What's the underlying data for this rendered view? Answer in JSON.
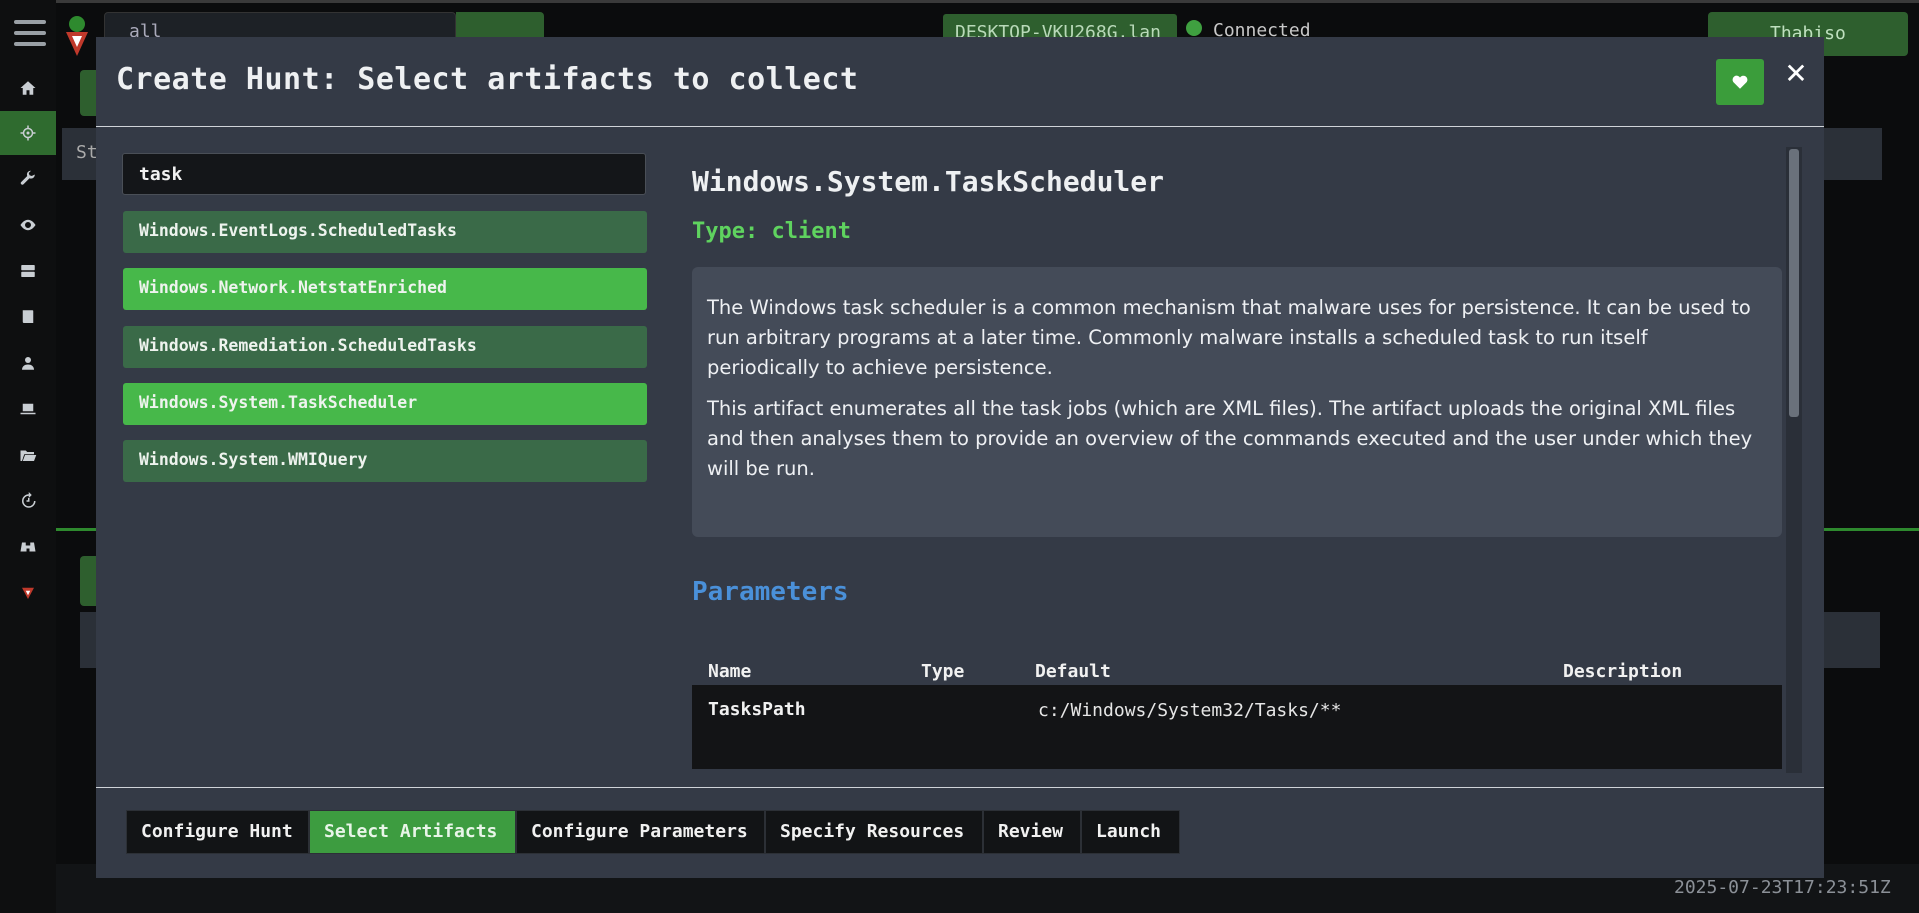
{
  "background": {
    "search_value": "all",
    "hostname": "DESKTOP-VKU268G.lan",
    "connection_status": "Connected",
    "user_name": "Thabiso",
    "table_header_start": "St",
    "timestamp": "2025-07-23T17:23:51Z"
  },
  "modal": {
    "title": "Create Hunt: Select artifacts to collect",
    "search_value": "task",
    "artifacts": [
      {
        "label": "Windows.EventLogs.ScheduledTasks",
        "selected": false
      },
      {
        "label": "Windows.Network.NetstatEnriched",
        "selected": true
      },
      {
        "label": "Windows.Remediation.ScheduledTasks",
        "selected": false
      },
      {
        "label": "Windows.System.TaskScheduler",
        "selected": true
      },
      {
        "label": "Windows.System.WMIQuery",
        "selected": false
      }
    ],
    "detail": {
      "name": "Windows.System.TaskScheduler",
      "type": "Type: client",
      "description": [
        "The Windows task scheduler is a common mechanism that malware uses for persistence. It can be used to run arbitrary programs at a later time. Commonly malware installs a scheduled task to run itself periodically to achieve persistence.",
        "This artifact enumerates all the task jobs (which are XML files). The artifact uploads the original XML files and then analyses them to provide an overview of the commands executed and the user under which they will be run."
      ],
      "parameters_heading": "Parameters",
      "param_columns": [
        "Name",
        "Type",
        "Default",
        "Description"
      ],
      "params": [
        {
          "name": "TasksPath",
          "type": "",
          "default": "c:/Windows/System32/Tasks/**",
          "description": ""
        }
      ]
    },
    "wizard_steps": [
      {
        "label": "Configure Hunt",
        "active": false
      },
      {
        "label": "Select Artifacts",
        "active": true
      },
      {
        "label": "Configure Parameters",
        "active": false
      },
      {
        "label": "Specify Resources",
        "active": false
      },
      {
        "label": "Review",
        "active": false
      },
      {
        "label": "Launch",
        "active": false
      }
    ]
  },
  "colors": {
    "accent_green": "#47b84a",
    "dim_green": "#3a6a48",
    "type_green": "#5fd35f",
    "heading_blue": "#4a90d9"
  },
  "icons": {
    "sidebar": [
      "home-icon",
      "crosshair-icon",
      "wrench-icon",
      "eye-icon",
      "server-icon",
      "book-icon",
      "user-icon",
      "laptop-icon",
      "folder-open-icon",
      "history-icon",
      "binoculars-icon",
      "velociraptor-logo-icon"
    ],
    "favorite": "heart-icon",
    "close": "close-icon"
  }
}
